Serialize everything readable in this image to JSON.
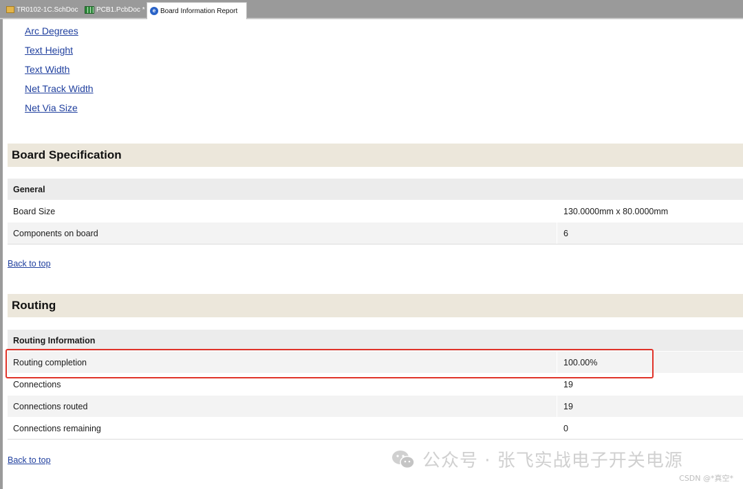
{
  "tabs": [
    {
      "label": "TR0102-1C.SchDoc",
      "icon": "schematic-icon",
      "active": false
    },
    {
      "label": "PCB1.PcbDoc *",
      "icon": "pcb-icon",
      "active": false
    },
    {
      "label": "Board Information Report",
      "icon": "report-icon",
      "active": true
    }
  ],
  "toc": {
    "links": [
      "Arc Degrees",
      "Text Height",
      "Text Width",
      "Net Track Width",
      "Net Via Size"
    ]
  },
  "board_spec": {
    "title": "Board Specification",
    "group": "General",
    "rows": [
      {
        "label": "Board Size",
        "value": "130.0000mm  x  80.0000mm"
      },
      {
        "label": "Components on board",
        "value": "6"
      }
    ],
    "back_link": "Back to top"
  },
  "routing": {
    "title": "Routing",
    "group": "Routing Information",
    "rows": [
      {
        "label": "Routing completion",
        "value": "100.00%"
      },
      {
        "label": "Connections",
        "value": "19"
      },
      {
        "label": "Connections routed",
        "value": "19"
      },
      {
        "label": "Connections remaining",
        "value": "0"
      }
    ],
    "back_link": "Back to top"
  },
  "watermark": {
    "text": "公众号 · 张飞实战电子开关电源",
    "credit": "CSDN @*真空*"
  },
  "colors": {
    "section_header_bg": "#ece7db",
    "link": "#1f3f9e",
    "highlight": "#e03228"
  }
}
